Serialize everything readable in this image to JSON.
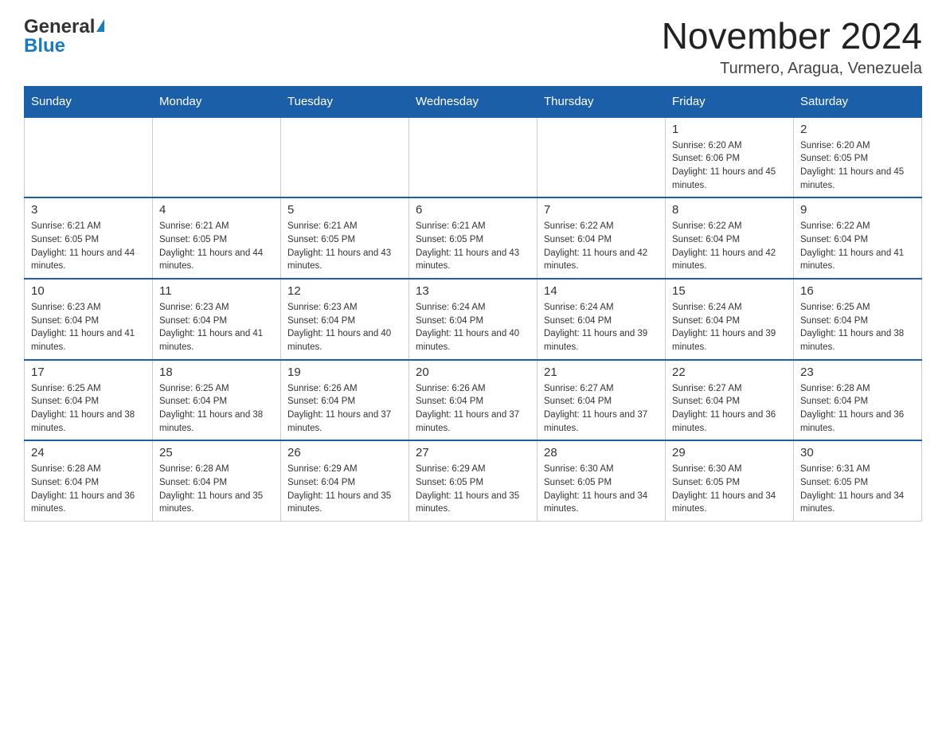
{
  "header": {
    "logo_general": "General",
    "logo_blue": "Blue",
    "month_title": "November 2024",
    "location": "Turmero, Aragua, Venezuela"
  },
  "calendar": {
    "days_of_week": [
      "Sunday",
      "Monday",
      "Tuesday",
      "Wednesday",
      "Thursday",
      "Friday",
      "Saturday"
    ],
    "weeks": [
      [
        {
          "day": "",
          "info": ""
        },
        {
          "day": "",
          "info": ""
        },
        {
          "day": "",
          "info": ""
        },
        {
          "day": "",
          "info": ""
        },
        {
          "day": "",
          "info": ""
        },
        {
          "day": "1",
          "info": "Sunrise: 6:20 AM\nSunset: 6:06 PM\nDaylight: 11 hours and 45 minutes."
        },
        {
          "day": "2",
          "info": "Sunrise: 6:20 AM\nSunset: 6:05 PM\nDaylight: 11 hours and 45 minutes."
        }
      ],
      [
        {
          "day": "3",
          "info": "Sunrise: 6:21 AM\nSunset: 6:05 PM\nDaylight: 11 hours and 44 minutes."
        },
        {
          "day": "4",
          "info": "Sunrise: 6:21 AM\nSunset: 6:05 PM\nDaylight: 11 hours and 44 minutes."
        },
        {
          "day": "5",
          "info": "Sunrise: 6:21 AM\nSunset: 6:05 PM\nDaylight: 11 hours and 43 minutes."
        },
        {
          "day": "6",
          "info": "Sunrise: 6:21 AM\nSunset: 6:05 PM\nDaylight: 11 hours and 43 minutes."
        },
        {
          "day": "7",
          "info": "Sunrise: 6:22 AM\nSunset: 6:04 PM\nDaylight: 11 hours and 42 minutes."
        },
        {
          "day": "8",
          "info": "Sunrise: 6:22 AM\nSunset: 6:04 PM\nDaylight: 11 hours and 42 minutes."
        },
        {
          "day": "9",
          "info": "Sunrise: 6:22 AM\nSunset: 6:04 PM\nDaylight: 11 hours and 41 minutes."
        }
      ],
      [
        {
          "day": "10",
          "info": "Sunrise: 6:23 AM\nSunset: 6:04 PM\nDaylight: 11 hours and 41 minutes."
        },
        {
          "day": "11",
          "info": "Sunrise: 6:23 AM\nSunset: 6:04 PM\nDaylight: 11 hours and 41 minutes."
        },
        {
          "day": "12",
          "info": "Sunrise: 6:23 AM\nSunset: 6:04 PM\nDaylight: 11 hours and 40 minutes."
        },
        {
          "day": "13",
          "info": "Sunrise: 6:24 AM\nSunset: 6:04 PM\nDaylight: 11 hours and 40 minutes."
        },
        {
          "day": "14",
          "info": "Sunrise: 6:24 AM\nSunset: 6:04 PM\nDaylight: 11 hours and 39 minutes."
        },
        {
          "day": "15",
          "info": "Sunrise: 6:24 AM\nSunset: 6:04 PM\nDaylight: 11 hours and 39 minutes."
        },
        {
          "day": "16",
          "info": "Sunrise: 6:25 AM\nSunset: 6:04 PM\nDaylight: 11 hours and 38 minutes."
        }
      ],
      [
        {
          "day": "17",
          "info": "Sunrise: 6:25 AM\nSunset: 6:04 PM\nDaylight: 11 hours and 38 minutes."
        },
        {
          "day": "18",
          "info": "Sunrise: 6:25 AM\nSunset: 6:04 PM\nDaylight: 11 hours and 38 minutes."
        },
        {
          "day": "19",
          "info": "Sunrise: 6:26 AM\nSunset: 6:04 PM\nDaylight: 11 hours and 37 minutes."
        },
        {
          "day": "20",
          "info": "Sunrise: 6:26 AM\nSunset: 6:04 PM\nDaylight: 11 hours and 37 minutes."
        },
        {
          "day": "21",
          "info": "Sunrise: 6:27 AM\nSunset: 6:04 PM\nDaylight: 11 hours and 37 minutes."
        },
        {
          "day": "22",
          "info": "Sunrise: 6:27 AM\nSunset: 6:04 PM\nDaylight: 11 hours and 36 minutes."
        },
        {
          "day": "23",
          "info": "Sunrise: 6:28 AM\nSunset: 6:04 PM\nDaylight: 11 hours and 36 minutes."
        }
      ],
      [
        {
          "day": "24",
          "info": "Sunrise: 6:28 AM\nSunset: 6:04 PM\nDaylight: 11 hours and 36 minutes."
        },
        {
          "day": "25",
          "info": "Sunrise: 6:28 AM\nSunset: 6:04 PM\nDaylight: 11 hours and 35 minutes."
        },
        {
          "day": "26",
          "info": "Sunrise: 6:29 AM\nSunset: 6:04 PM\nDaylight: 11 hours and 35 minutes."
        },
        {
          "day": "27",
          "info": "Sunrise: 6:29 AM\nSunset: 6:05 PM\nDaylight: 11 hours and 35 minutes."
        },
        {
          "day": "28",
          "info": "Sunrise: 6:30 AM\nSunset: 6:05 PM\nDaylight: 11 hours and 34 minutes."
        },
        {
          "day": "29",
          "info": "Sunrise: 6:30 AM\nSunset: 6:05 PM\nDaylight: 11 hours and 34 minutes."
        },
        {
          "day": "30",
          "info": "Sunrise: 6:31 AM\nSunset: 6:05 PM\nDaylight: 11 hours and 34 minutes."
        }
      ]
    ]
  }
}
